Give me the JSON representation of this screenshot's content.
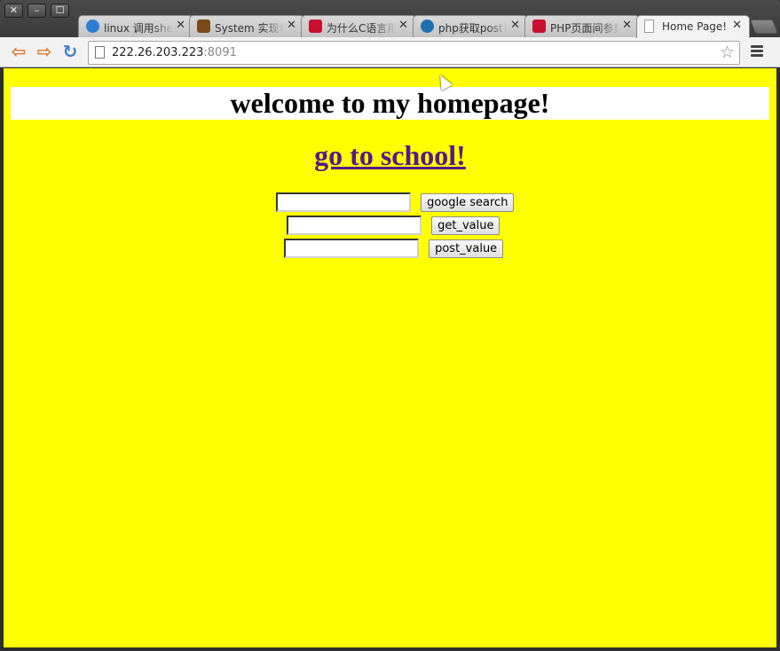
{
  "window": {
    "controls": {
      "close": "✕",
      "minimize": "–",
      "maximize": "☐"
    }
  },
  "tabs": [
    {
      "title": "linux 调用she",
      "icon": "generic-site-icon",
      "icon_color": "#2d7fd6",
      "active": false
    },
    {
      "title": "System 实现机",
      "icon": "docin-icon",
      "icon_color": "#7a4a1a",
      "active": false
    },
    {
      "title": "为什么C语言用",
      "icon": "csdn-icon",
      "icon_color": "#c8102e",
      "active": false
    },
    {
      "title": "php获取post请",
      "icon": "chinaunix-icon",
      "icon_color": "#1f6fb0",
      "active": false
    },
    {
      "title": "PHP页面间参数",
      "icon": "csdn-icon",
      "icon_color": "#c8102e",
      "active": false
    },
    {
      "title": "Home Page!",
      "icon": "page-icon",
      "icon_color": "#ffffff",
      "active": true
    }
  ],
  "toolbar": {
    "url_host": "222.26.203.223",
    "url_port": ":8091"
  },
  "page": {
    "background": "#ffff00",
    "heading": "welcome to my homepage!",
    "school_link": "go to school!",
    "link_color": "#551a8b",
    "forms": [
      {
        "input_value": "",
        "button": "google search"
      },
      {
        "input_value": "",
        "button": "get_value"
      },
      {
        "input_value": "",
        "button": "post_value"
      }
    ]
  }
}
